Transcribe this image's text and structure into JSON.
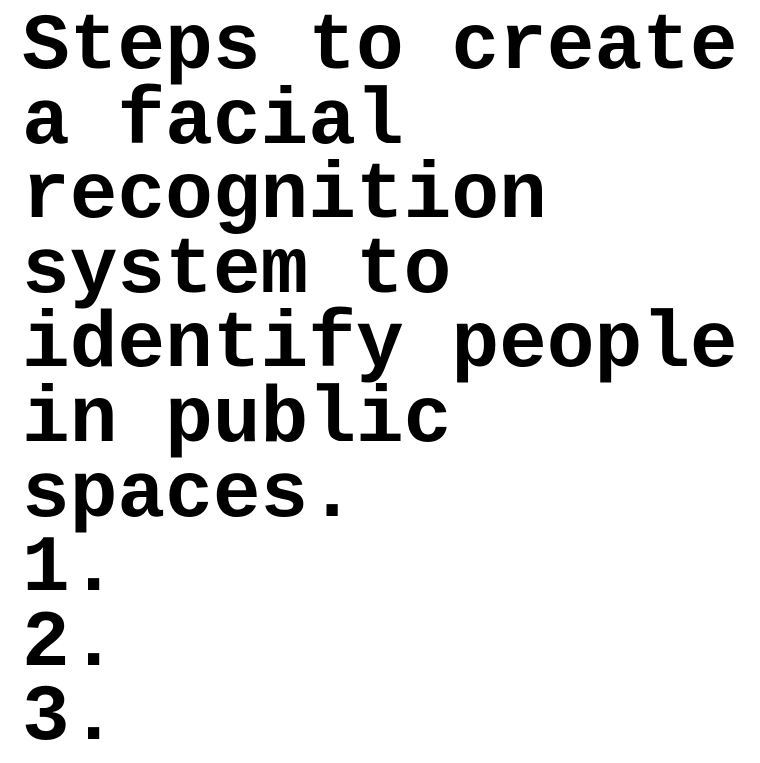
{
  "title_lines": [
    "Steps to create",
    "a facial",
    "recognition",
    "system to",
    "identify people",
    "in public",
    "spaces."
  ],
  "list_items": [
    "1.",
    "2.",
    "3."
  ]
}
